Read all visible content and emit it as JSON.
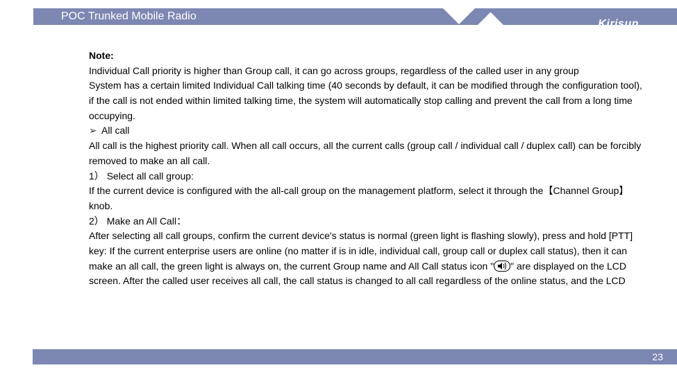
{
  "header": {
    "title": "POC Trunked Mobile Radio",
    "logo": "Kirisun"
  },
  "body": {
    "note_label": "Note:",
    "note_p1": "Individual Call priority is higher than Group call, it can go across groups, regardless of the called user in any group",
    "note_p2": "System has a certain limited Individual Call talking time (40 seconds by default, it can be modified through the configuration tool), if the call is not ended within limited talking time, the system will automatically stop calling and prevent the call from a long time occupying.",
    "bullet_marker": "➢",
    "allcall_label": "All call",
    "allcall_p": "All call is the highest priority call. When all call occurs, all the current calls (group call / individual call / duplex call) can be forcibly removed to make an all call.",
    "step1_num": "1）  ",
    "step1_title": "Select all call group:",
    "step1_p_a": "If the current device is configured with the all-call group on the management platform, select it through the【Channel Group】knob.",
    "step2_num": "2）  ",
    "step2_title": "Make an All Call：",
    "step2_p_a": "After selecting all call groups, confirm the current device's status is normal (green light is flashing slowly), press and hold [PTT] key: If the current enterprise users are online (no matter if is in idle, individual call, group call or duplex call status), then it can make an all call, the green light is always on, the current Group name and All Call status icon \"",
    "step2_p_b": "\" are displayed on the LCD screen. After the called user receives all call, the call status is changed to all call regardless of the online status, and the LCD"
  },
  "footer": {
    "page_number": "23"
  }
}
